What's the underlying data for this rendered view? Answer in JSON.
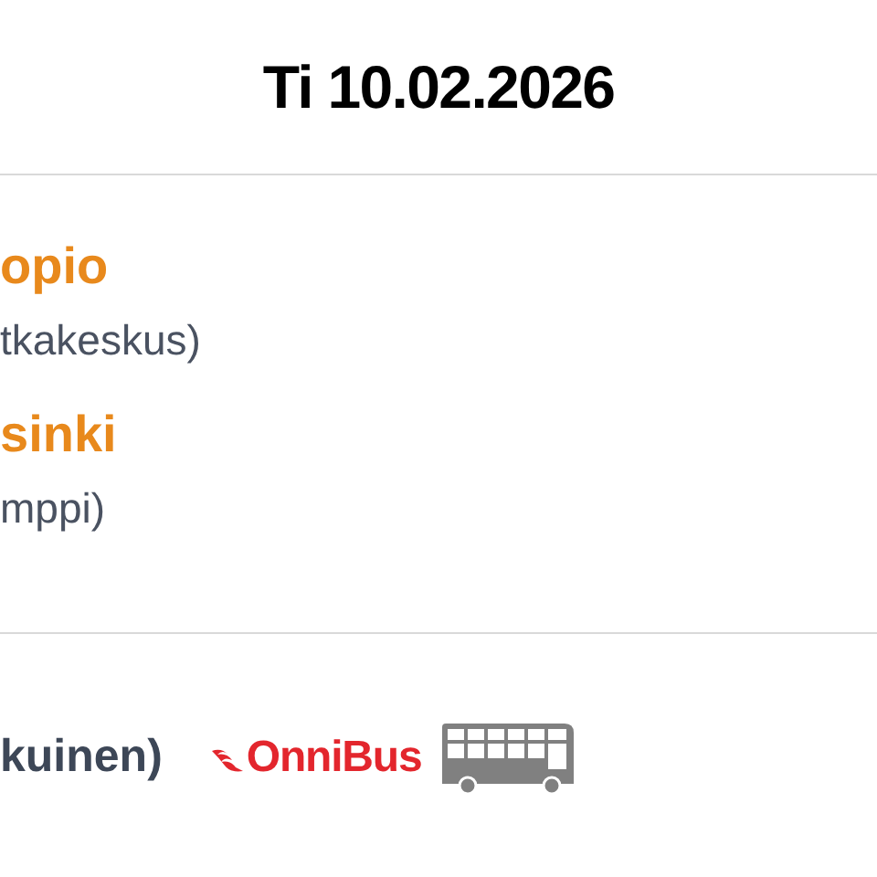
{
  "header": {
    "date": "Ti 10.02.2026"
  },
  "route": [
    {
      "city": "opio",
      "station": "tkakeskus)"
    },
    {
      "city": "sinki",
      "station": "mppi)"
    }
  ],
  "trip": {
    "type_text": "kuinen)",
    "operator": "OnniBus"
  }
}
